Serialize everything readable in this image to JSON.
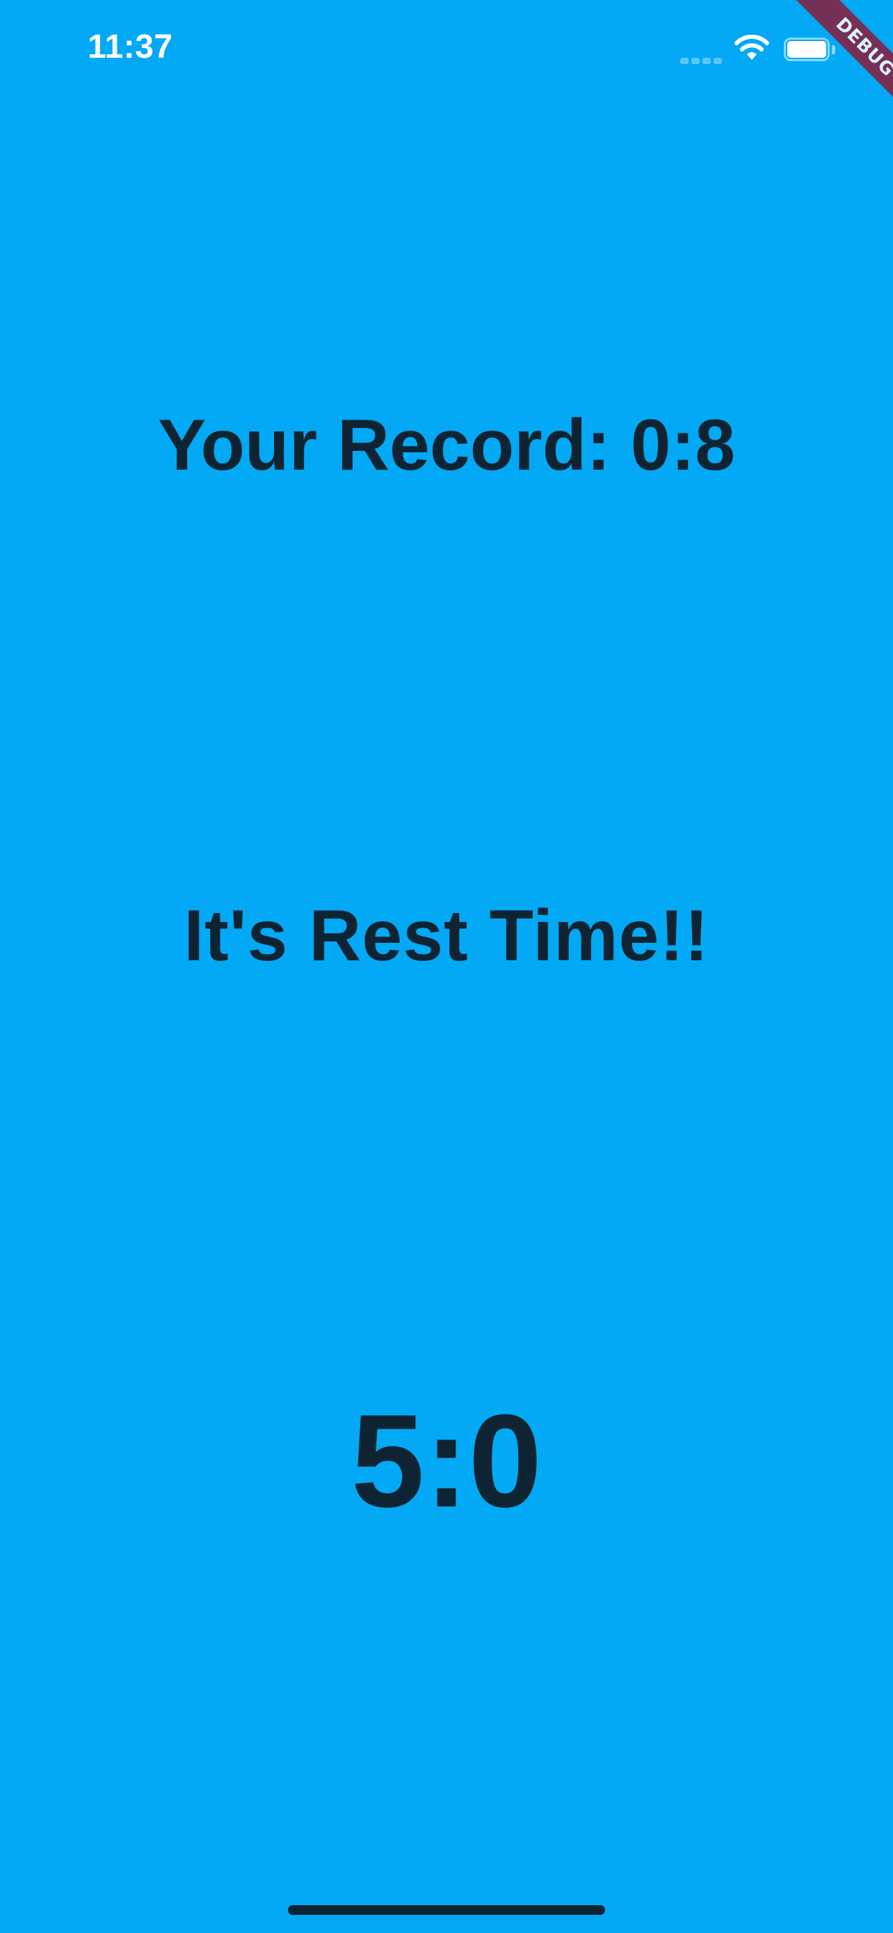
{
  "status_bar": {
    "time": "11:37",
    "icons": [
      "cellular-signal-icon",
      "wifi-icon",
      "battery-icon"
    ]
  },
  "debug_banner": {
    "label": "DEBUG",
    "color": "#8B1A3A"
  },
  "main": {
    "record_label": "Your Record: 0:8",
    "status_message": "It's Rest Time!!",
    "timer_value": "5:0"
  },
  "colors": {
    "background": "#03A9F4",
    "text": "#0F2433",
    "status_text": "#FFFFFF"
  }
}
